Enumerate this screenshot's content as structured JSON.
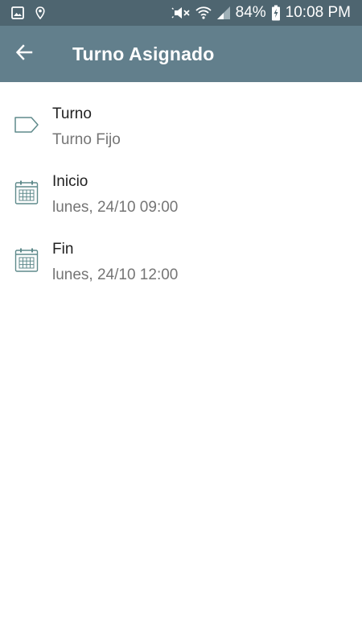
{
  "status_bar": {
    "battery": "84%",
    "time": "10:08 PM",
    "icons": [
      "image-icon",
      "location-icon",
      "mute-icon",
      "wifi-icon",
      "signal-icon",
      "battery-charging-icon"
    ]
  },
  "app_bar": {
    "title": "Turno Asignado",
    "back_icon": "back-arrow-icon"
  },
  "details": [
    {
      "icon": "tag-icon",
      "label": "Turno",
      "value": "Turno Fijo"
    },
    {
      "icon": "calendar-icon",
      "label": "Inicio",
      "value": "lunes, 24/10 09:00"
    },
    {
      "icon": "calendar-icon",
      "label": "Fin",
      "value": "lunes, 24/10 12:00"
    }
  ],
  "colors": {
    "status_bar": "#4e6570",
    "app_bar": "#627f8c",
    "icon_accent": "#5f8a8b"
  }
}
